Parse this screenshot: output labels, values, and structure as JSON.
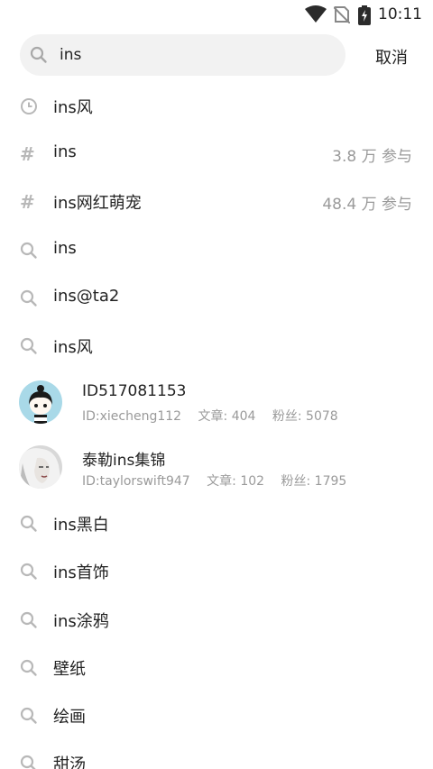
{
  "status_bar": {
    "time": "10:11"
  },
  "search": {
    "value": "ins",
    "cancel_label": "取消"
  },
  "history_items": [
    {
      "label": "ins风"
    }
  ],
  "topic_items": [
    {
      "label": "ins",
      "count": "3.8 万 参与"
    },
    {
      "label": "ins网红萌宠",
      "count": "48.4 万 参与"
    }
  ],
  "suggestions_a": [
    {
      "label": "ins"
    },
    {
      "label": "ins@ta2"
    },
    {
      "label": "ins风"
    }
  ],
  "users": [
    {
      "name": "ID517081153",
      "id": "ID:xiecheng112",
      "articles": "文章: 404",
      "fans": "粉丝: 5078"
    },
    {
      "name": "泰勒ins集锦",
      "id": "ID:taylorswift947",
      "articles": "文章: 102",
      "fans": "粉丝: 1795"
    }
  ],
  "suggestions_b": [
    {
      "label": "ins黑白"
    },
    {
      "label": "ins首饰"
    },
    {
      "label": "ins涂鸦"
    },
    {
      "label": "壁纸"
    },
    {
      "label": "绘画"
    },
    {
      "label": "甜汤"
    }
  ]
}
